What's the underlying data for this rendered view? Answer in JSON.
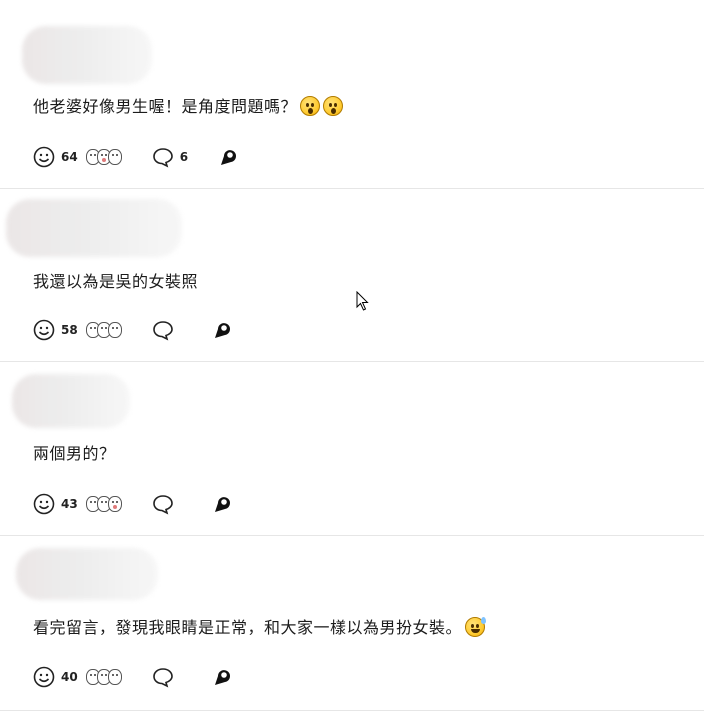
{
  "comments": [
    {
      "text": "他老婆好像男生喔！是角度問題嗎？",
      "emojis": [
        "astonished-face",
        "astonished-face"
      ],
      "reaction_count": "64",
      "reply_count": "6"
    },
    {
      "text": "我還以為是吳的女裝照",
      "emojis": [],
      "reaction_count": "58",
      "reply_count": ""
    },
    {
      "text": "兩個男的？",
      "emojis": [],
      "reaction_count": "43",
      "reply_count": ""
    },
    {
      "text": "看完留言，發現我眼睛是正常，和大家一樣以為男扮女裝。",
      "emojis": [
        "sweat-smile-face"
      ],
      "reaction_count": "40",
      "reply_count": ""
    }
  ],
  "icons": {
    "react": "smiley-outline-icon",
    "reply": "speech-bubble-icon",
    "share": "share-bubble-icon"
  },
  "colors": {
    "divider": "#e6e6e6",
    "text": "#1c1c1c"
  }
}
